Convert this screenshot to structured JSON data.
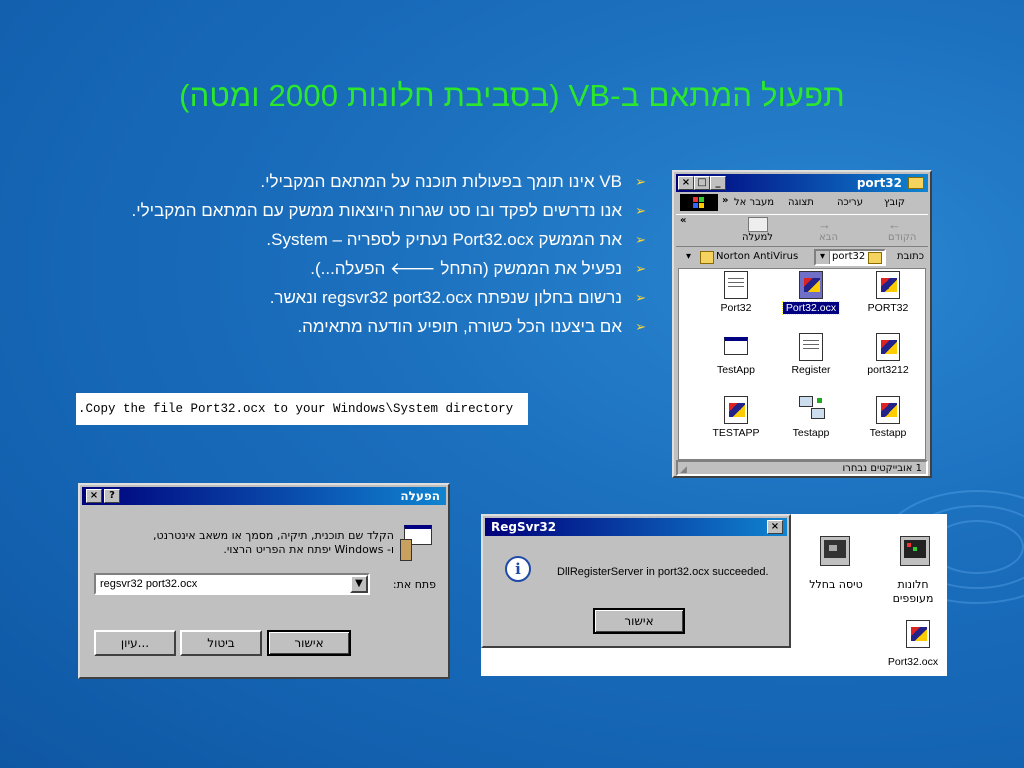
{
  "slide": {
    "title": "תפעול המתאם ב-VB (בסביבת חלונות 2000 ומטה)",
    "bullets": [
      "VB אינו תומך בפעולות תוכנה על המתאם המקבילי.",
      "אנו נדרשים לפקד ובו סט שגרות היוצאות ממשק עם המתאם המקבילי.",
      "את הממשק Port32.ocx נעתיק לספריה – System.",
      "נפעיל את הממשק (התחל 🡐 הפעלה...).",
      "נרשום בחלון שנפתח  regsvr32 port32.ocx ונאשר.",
      "אם ביצענו הכל כשורה, תופיע הודעה מתאימה."
    ],
    "bullet_marker": "➢",
    "code_line": ".Copy the file Port32.ocx to your Windows\\System directory"
  },
  "explorer": {
    "title": "port32",
    "menu": [
      "קובץ",
      "עריכה",
      "תצוגה",
      "מעבר אל"
    ],
    "menu_more": "»",
    "toolbar": {
      "more": "«",
      "back": "הקודם",
      "forward": "הבא",
      "up": "למעלה"
    },
    "address_label": "כתובת",
    "address_value": "port32",
    "links_label": "Norton AntiVirus",
    "files": [
      {
        "name": "PORT32",
        "type": "ocx"
      },
      {
        "name": "Port32.ocx",
        "type": "ocx-selected"
      },
      {
        "name": "Port32",
        "type": "doc"
      },
      {
        "name": "port3212",
        "type": "ocx"
      },
      {
        "name": "Register",
        "type": "doc"
      },
      {
        "name": "TestApp",
        "type": "app"
      },
      {
        "name": "Testapp",
        "type": "ocx"
      },
      {
        "name": "Testapp",
        "type": "network"
      },
      {
        "name": "TESTAPP",
        "type": "ocx"
      }
    ],
    "status": "1 אובייקטים נבחרו",
    "window_buttons": {
      "min": "_",
      "max": "□",
      "close": "×"
    }
  },
  "run_dialog": {
    "title": "הפעלה",
    "help": "?",
    "close": "×",
    "description_line1": "הקלד שם תוכנית, תיקיה, מסמך או משאב אינטרנט,",
    "description_line2": "ו- Windows יפתח את הפריט הרצוי.",
    "open_label": "פתח את:",
    "open_value": "regsvr32 port32.ocx",
    "ok": "אישור",
    "cancel": "ביטול",
    "browse": "עיון..."
  },
  "regsvr": {
    "title": "RegSvr32",
    "close": "×",
    "message": "DllRegisterServer in port32.ocx succeeded.",
    "ok": "אישור"
  },
  "desktop_icons": [
    {
      "label_line1": "חלונות",
      "label_line2": "מעופפים"
    },
    {
      "label_line1": "טיסה בחלל",
      "label_line2": ""
    },
    {
      "label_line1": "Port32.ocx",
      "label_line2": ""
    }
  ]
}
